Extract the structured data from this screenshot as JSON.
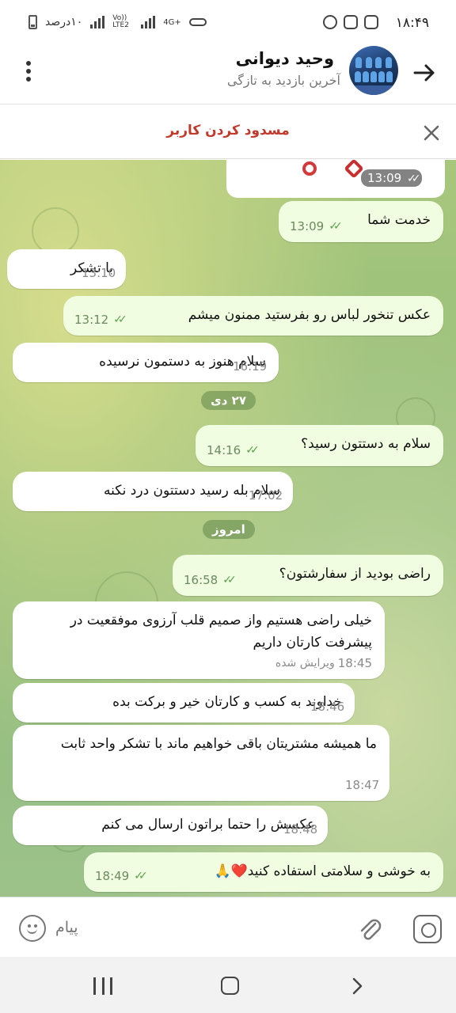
{
  "status_bar": {
    "time": "۱۸:۴۹",
    "battery_label": "۱۰درصد",
    "network_label": "4G+",
    "volte_label": "Vo)) LTE2"
  },
  "header": {
    "contact_name": "وحید دیوانی",
    "contact_status": "آخرین بازدید به تازگی",
    "back_icon": "arrow-right-icon",
    "menu_icon": "more-vertical-icon"
  },
  "block_bar": {
    "label": "مسدود کردن کاربر",
    "close_icon": "close-icon"
  },
  "chat": {
    "photo_time": "13:09",
    "messages": [
      {
        "dir": "out",
        "text": "خدمت شما",
        "time": "13:09"
      },
      {
        "dir": "in",
        "text": "با تشکر",
        "time": "13:10"
      },
      {
        "dir": "out",
        "text": "عکس تنخور لباس رو بفرستید ممنون میشم",
        "time": "13:12"
      },
      {
        "dir": "in",
        "text": "سلام هنوز به دستمون نرسیده",
        "time": "16:19"
      },
      {
        "dir": "out",
        "text": "سلام به دستتون رسید؟",
        "time": "14:16"
      },
      {
        "dir": "in",
        "text": "سلام بله رسید دستتون درد نکنه",
        "time": "17:02"
      },
      {
        "dir": "out",
        "text": "راضی بودید از سفارشتون؟",
        "time": "16:58"
      },
      {
        "dir": "in",
        "text": "خیلی راضی هستیم واز صمیم قلب آرزوی موفقعیت در پیشرفت کارتان داریم",
        "time": "18:45",
        "edited": "ویرایش شده"
      },
      {
        "dir": "in",
        "text": "خداوند به کسب و کارتان خیر و برکت بده",
        "time": "18:46"
      },
      {
        "dir": "in",
        "text": "ما همیشه مشتریتان باقی خواهیم ماند با تشکر واحد ثابت",
        "time": "18:47"
      },
      {
        "dir": "in",
        "text": "عکسش را حتما براتون ارسال می کنم",
        "time": "18:48"
      },
      {
        "dir": "out",
        "text": "به خوشی و سلامتی استفاده کنید❤️🙏",
        "time": "18:49"
      }
    ],
    "date_separators": [
      "۲۷ دی",
      "امروز"
    ]
  },
  "input_bar": {
    "placeholder": "پیام",
    "emoji_icon": "emoji-icon",
    "attach_icon": "paperclip-icon",
    "camera_icon": "camera-icon"
  },
  "nav_bar": {
    "recent_icon": "recent-apps-icon",
    "home_icon": "home-icon",
    "back_icon": "back-icon"
  },
  "colors": {
    "outgoing_bubble": "#f0fde0",
    "incoming_bubble": "#ffffff",
    "block_red": "#c0392b",
    "check_green": "#5aa14c"
  }
}
